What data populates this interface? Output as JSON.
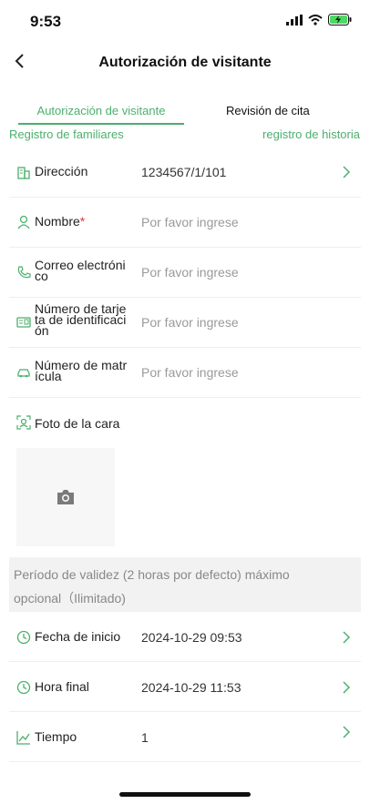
{
  "status_bar": {
    "time": "9:53"
  },
  "nav": {
    "title": "Autorización de visitante"
  },
  "tabs": [
    {
      "label": "Autorización de visitante"
    },
    {
      "label": "Revisión de cita"
    }
  ],
  "links": {
    "family": "Registro de familiares",
    "history": "registro de historia"
  },
  "form": {
    "address": {
      "label": "Dirección",
      "value": "1234567/1/101"
    },
    "name": {
      "label": "Nombre",
      "required_mark": "*",
      "placeholder": "Por favor ingrese"
    },
    "email": {
      "label_line1": "Correo electróni",
      "label_line2": "co",
      "placeholder": "Por favor ingrese"
    },
    "id_card": {
      "label_line1": "Número de tarje",
      "label_line2": "ta de identificaci",
      "label_line3": "ón",
      "placeholder": "Por favor ingrese"
    },
    "plate": {
      "label_line1": "Número de matr",
      "label_line2": "ícula",
      "placeholder": "Por favor ingrese"
    },
    "face_photo": {
      "label": "Foto de la cara"
    }
  },
  "validity": {
    "line1": "Período de validez (2 horas por defecto) máximo",
    "line2": "opcional（Ilimitado)"
  },
  "schedule": {
    "start": {
      "label": "Fecha de inicio",
      "value": "2024-10-29 09:53"
    },
    "end": {
      "label": "Hora final",
      "value": "2024-10-29 11:53"
    },
    "duration": {
      "label": "Tiempo",
      "value": "1"
    }
  },
  "colors": {
    "accent": "#4caf6d",
    "required": "#e53935",
    "placeholder": "#9a9a9a"
  },
  "icons": [
    "building-icon",
    "person-icon",
    "phone-icon",
    "id-card-icon",
    "car-icon",
    "face-scan-icon",
    "camera-icon",
    "clock-icon",
    "trend-icon",
    "chevron-right-icon",
    "back-icon"
  ]
}
